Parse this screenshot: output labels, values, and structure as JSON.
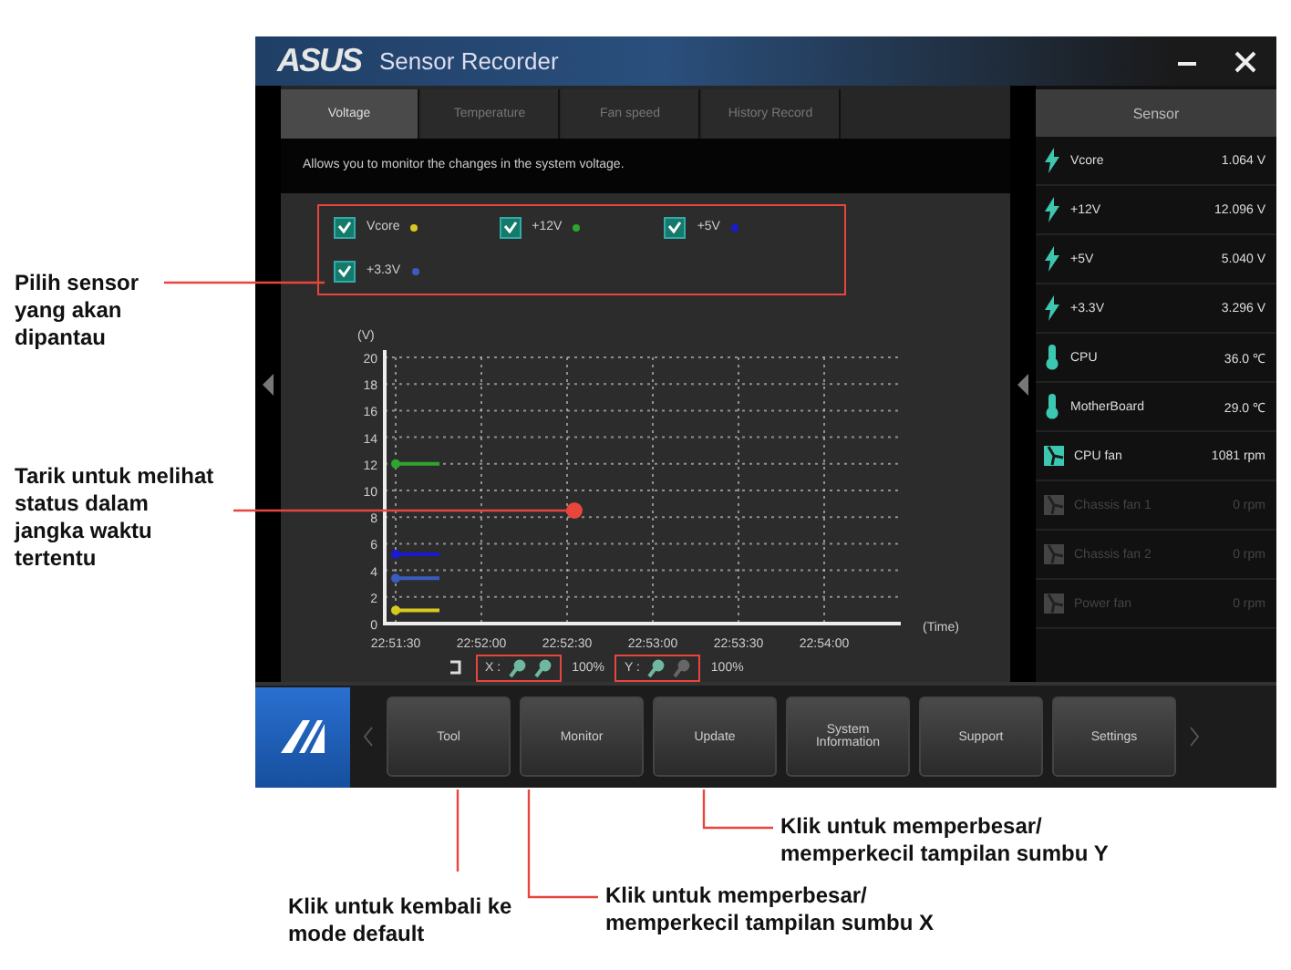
{
  "window": {
    "logo": "ASUS",
    "title": "Sensor Recorder"
  },
  "tabs": [
    {
      "label": "Voltage",
      "selected": true
    },
    {
      "label": "Temperature",
      "selected": false
    },
    {
      "label": "Fan speed",
      "selected": false
    },
    {
      "label": "History Record",
      "selected": false
    }
  ],
  "description": "Allows you to monitor the changes in the system voltage.",
  "sensor_select": [
    {
      "checked": true
    },
    {
      "checked": true
    },
    {
      "checked": true
    },
    {
      "checked": true
    }
  ],
  "chart": {
    "chart_data": {
      "type": "line",
      "grid": true,
      "ylabel": "(V)",
      "xlabel": "(Time)",
      "categories": [
        "22:51:30",
        "22:52:00",
        "22:52:30",
        "22:53:00",
        "22:53:30",
        "22:54:00"
      ],
      "ylim": [
        0,
        20
      ],
      "yticks": [
        0,
        2,
        4,
        6,
        8,
        10,
        12,
        14,
        16,
        18,
        20
      ],
      "series": [
        {
          "name": "Vcore",
          "color": "#d8c820",
          "marker": true,
          "values": [
            1,
            null,
            null,
            null,
            null,
            null
          ]
        },
        {
          "name": "+12V",
          "color": "#2fa52f",
          "marker": true,
          "values": [
            12,
            null,
            null,
            null,
            null,
            null
          ]
        },
        {
          "name": "+5V",
          "color": "#1a1ad0",
          "marker": true,
          "values": [
            5.2,
            null,
            null,
            null,
            null,
            null
          ]
        },
        {
          "name": "+3.3V",
          "color": "#3a5cc0",
          "marker": true,
          "values": [
            3.4,
            null,
            null,
            null,
            null,
            null
          ]
        }
      ]
    }
  },
  "zoom": {
    "x_label": "X :",
    "x_value": "100%",
    "y_label": "Y :",
    "y_value": "100%"
  },
  "sensor_panel": {
    "title": "Sensor",
    "rows": [
      {
        "kind": "voltage",
        "name": "Vcore",
        "value": "1.064 V",
        "disabled": false
      },
      {
        "kind": "voltage",
        "name": "+12V",
        "value": "12.096 V",
        "disabled": false
      },
      {
        "kind": "voltage",
        "name": "+5V",
        "value": "5.040 V",
        "disabled": false
      },
      {
        "kind": "voltage",
        "name": "+3.3V",
        "value": "3.296 V",
        "disabled": false
      },
      {
        "kind": "temperature",
        "name": "CPU",
        "value": "36.0 ℃",
        "disabled": false
      },
      {
        "kind": "temperature",
        "name": "MotherBoard",
        "value": "29.0 ℃",
        "disabled": false
      },
      {
        "kind": "fan",
        "name": "CPU fan",
        "value": "1081 rpm",
        "disabled": false
      },
      {
        "kind": "fan",
        "name": "Chassis fan 1",
        "value": "0 rpm",
        "disabled": true
      },
      {
        "kind": "fan",
        "name": "Chassis fan 2",
        "value": "0 rpm",
        "disabled": true
      },
      {
        "kind": "fan",
        "name": "Power fan",
        "value": "0 rpm",
        "disabled": true
      }
    ]
  },
  "nav_buttons": [
    "Tool",
    "Monitor",
    "Update",
    "System Information",
    "Support",
    "Settings"
  ],
  "callouts": [
    "Pilih sensor yang akan dipantau",
    "Tarik untuk melihat status dalam jangka waktu tertentu",
    "Klik untuk kembali ke mode default",
    "Klik untuk memperbesar/ memperkecil tampilan sumbu X",
    "Klik untuk memperbesar/ memperkecil tampilan sumbu Y"
  ]
}
